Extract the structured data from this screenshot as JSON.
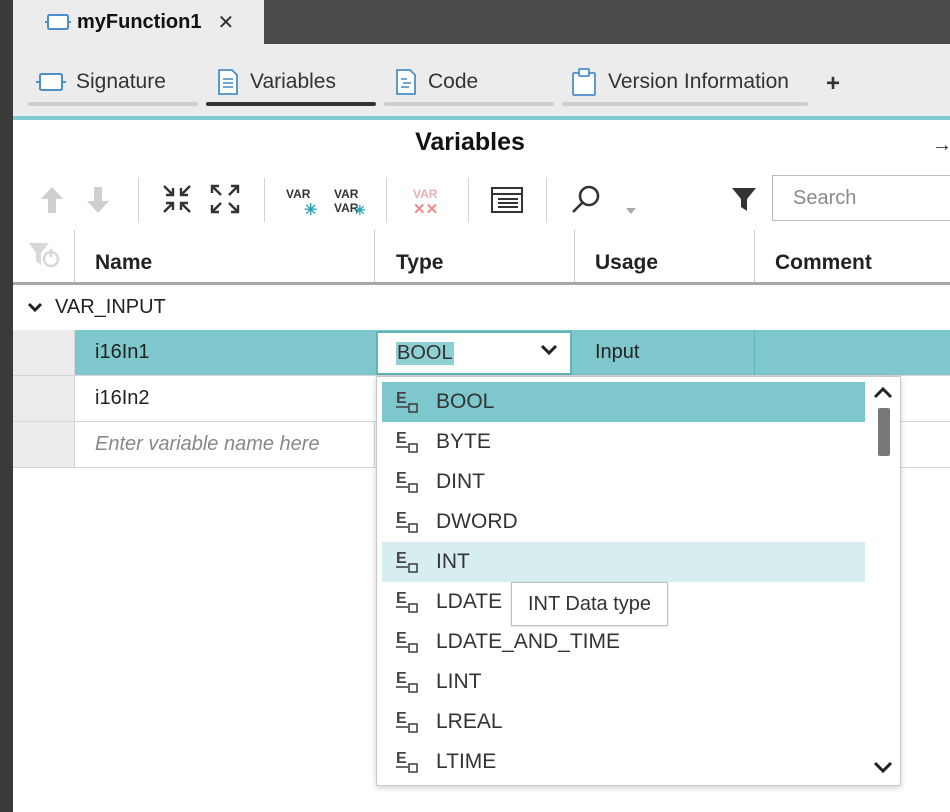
{
  "document_tab": {
    "title": "myFunction1",
    "close_label": "✕"
  },
  "editor_tabs": [
    {
      "label": "Signature",
      "active": false
    },
    {
      "label": "Variables",
      "active": true
    },
    {
      "label": "Code",
      "active": false
    },
    {
      "label": "Version Information",
      "active": false
    }
  ],
  "add_tab_label": "+",
  "panel": {
    "title": "Variables",
    "pin_label": "→"
  },
  "toolbar": {
    "search_placeholder": "Search",
    "icons": [
      "move-up-icon",
      "move-down-icon",
      "collapse-all-icon",
      "expand-all-icon",
      "add-variable-icon",
      "insert-variable-icon",
      "delete-variable-icon",
      "table-view-icon",
      "find-icon",
      "filter-icon"
    ],
    "var_text": "VAR"
  },
  "table": {
    "columns": [
      "Name",
      "Type",
      "Usage",
      "Comment"
    ],
    "group": {
      "label": "VAR_INPUT"
    },
    "rows": [
      {
        "name": "i16In1",
        "type": "BOOL",
        "usage": "Input",
        "comment": "",
        "selected": true
      },
      {
        "name": "i16In2",
        "type": "",
        "usage": "",
        "comment": "",
        "selected": false
      }
    ],
    "new_row_placeholder": "Enter variable name here"
  },
  "type_dropdown": {
    "current_value": "BOOL",
    "options": [
      "BOOL",
      "BYTE",
      "DINT",
      "DWORD",
      "INT",
      "LDATE",
      "LDATE_AND_TIME",
      "LINT",
      "LREAL",
      "LTIME"
    ],
    "selected_option": "BOOL",
    "hovered_option": "INT"
  },
  "tooltip": {
    "text": "INT Data type"
  },
  "colors": {
    "accent": "#7ec9d3",
    "row_selected": "#7ec8cd",
    "option_hover": "#d6eef0",
    "dark_chrome": "#4a4a4a"
  }
}
